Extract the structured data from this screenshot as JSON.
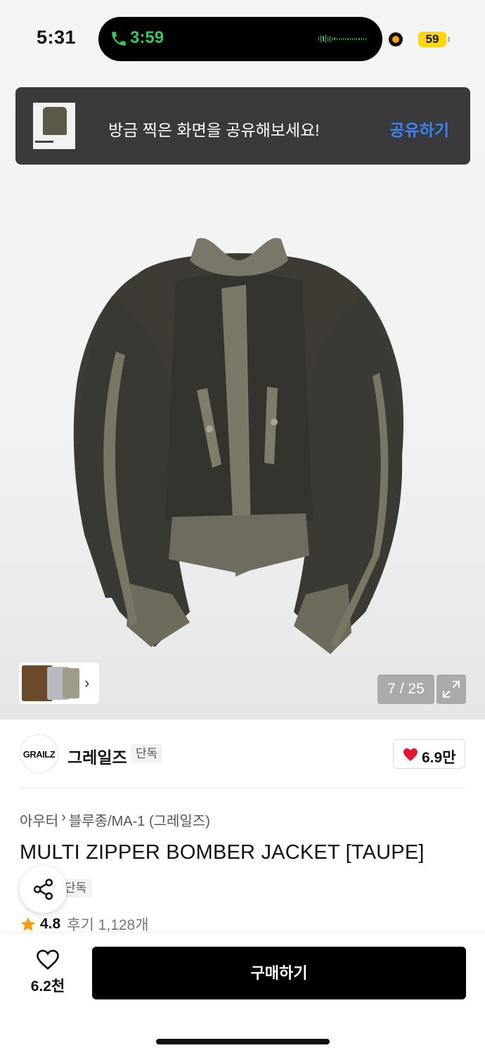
{
  "status_bar": {
    "time": "5:31",
    "call_time": "3:59",
    "battery": "59"
  },
  "share_toast": {
    "message": "방금 찍은 화면을 공유해보세요!",
    "action": "공유하기"
  },
  "gallery": {
    "counter": "7 / 25"
  },
  "brand": {
    "logo_text": "GRAILZ",
    "name": "그레일즈",
    "badge": "단독",
    "likes": "6.9만"
  },
  "product": {
    "category": "아우터",
    "subcategory": "블루종/MA-1 (그레일즈)",
    "title": "MULTI ZIPPER BOMBER JACKET [TAUPE]",
    "exclusive_tag": "단독",
    "rating": "4.8",
    "reviews": "후기 1,128개"
  },
  "bottom_bar": {
    "wish_count": "6.2천",
    "buy_label": "구매하기"
  },
  "colors": {
    "accent_blue": "#3b82f6",
    "call_green": "#34c759",
    "heart_red": "#e0182a",
    "star_orange": "#f59e0b"
  }
}
